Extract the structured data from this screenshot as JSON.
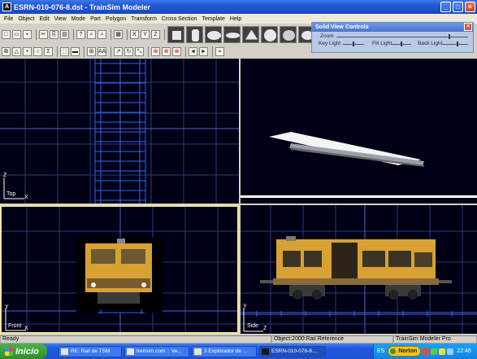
{
  "window": {
    "title": "ESRN-010-076-8.dst - TrainSim Modeler",
    "icon_glyph": "A"
  },
  "window_buttons": {
    "minimize": "_",
    "maximize": "□",
    "close": "×"
  },
  "menu": [
    "File",
    "Object",
    "Edit",
    "View",
    "Mode",
    "Part",
    "Polygon",
    "Transform",
    "Cross Section",
    "Template",
    "Help"
  ],
  "toolbar1": [
    "new-icon",
    "open-icon",
    "save-icon",
    "cut-icon",
    "copy-icon",
    "paste-icon",
    "help-icon",
    "zoom-in-icon",
    "zoom-out-icon",
    "grid-icon",
    "mirror-x-icon",
    "mirror-y-icon",
    "mirror-z-icon"
  ],
  "toolbar1_glyphs": [
    "□",
    "▭",
    "▪",
    "✂",
    "⎘",
    "▤",
    "?",
    "⌕",
    "⌕",
    "▦",
    "X",
    "Y",
    "Z"
  ],
  "shape_tools": [
    "box-shape-icon",
    "cylinder-shape-icon",
    "disc-shape-icon",
    "ellipsoid-shape-icon",
    "cone-shape-icon",
    "sphere-shape-icon",
    "dome-shape-icon",
    "torus-shape-icon"
  ],
  "toolbar2": [
    "select-polygon-icon",
    "triangle-icon",
    "point-icon",
    "circle-icon",
    "sigma-icon",
    "rect-select-icon",
    "line-icon",
    "texture-icon",
    "aa-text-icon",
    "rotate-icon",
    "reverse-icon",
    "scale-icon",
    "delete-part-icon",
    "delete-poly-icon",
    "delete-point-icon",
    "prev-icon",
    "next-icon",
    "binoculars-icon"
  ],
  "toolbar2_glyphs": [
    "⧉",
    "△",
    "•",
    "○",
    "Σ",
    "⬚",
    "▬",
    "⊞",
    "AA",
    "↗",
    "↻",
    "⤡",
    "⊗",
    "⊗",
    "⊗",
    "◄",
    "►",
    "⌖"
  ],
  "solid_view_controls": {
    "title": "Solid View Controls",
    "close": "×",
    "zoom_label": "Zoom",
    "zoom_value": 0.86,
    "key_light_label": "Key Light",
    "key_light_value": 0.5,
    "fill_light_label": "Fill Light",
    "fill_light_value": 0.5,
    "back_light_label": "Back Light",
    "back_light_value": 0.6
  },
  "viewports": {
    "top": {
      "label": "Top",
      "axis_v": "Z",
      "axis_h": "X"
    },
    "solid": {
      "label": ""
    },
    "front": {
      "label": "Front",
      "axis_v": "Y",
      "axis_h": "X"
    },
    "side": {
      "label": "Side",
      "axis_v": "Y",
      "axis_h": "Z"
    }
  },
  "colors": {
    "viewport_bg": "#000016",
    "grid": "#2a3d72",
    "axis": "#4d63c8",
    "active_border": "#f3e9a0",
    "train_yellow": "#d8a134",
    "wireframe": "#2f62ff"
  },
  "status": {
    "left": "Ready",
    "object": "Object:2000:Rail Reference",
    "app": "TrainSim Modeler Pro"
  },
  "taskbar": {
    "start_label": "Inicio",
    "tasks": [
      "RE: Rail de TSM",
      "trensim.com :: Ve...",
      "3 Explorador de ...",
      "ESRN-010-076-8...."
    ],
    "language": "ES",
    "norton_label": "Norton",
    "clock": "22:46"
  }
}
